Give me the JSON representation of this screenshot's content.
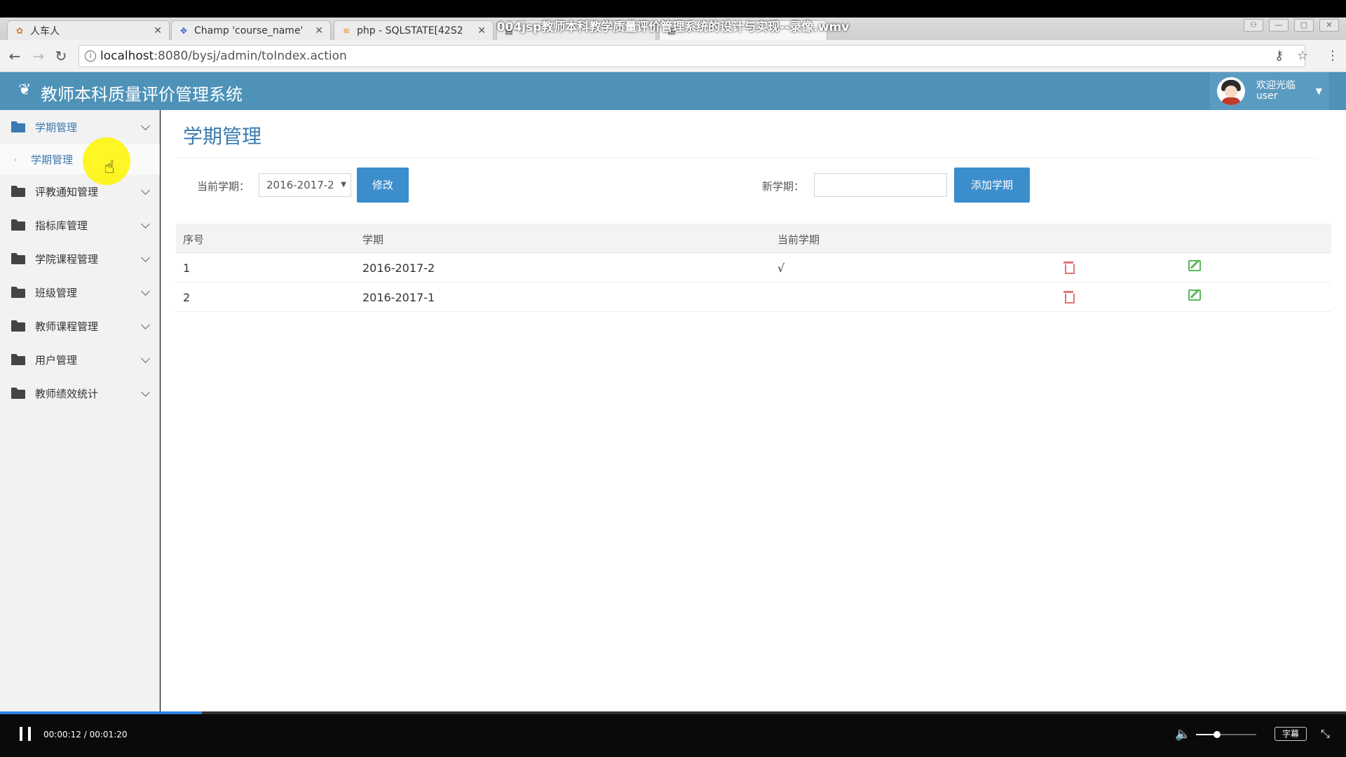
{
  "video": {
    "title": "004jsp教师本科教学质量评价管理系统的设计与实现--录像.wmv",
    "current_time": "00:00:12",
    "total_time": "00:01:20",
    "progress": 0.15,
    "time_separator": "/",
    "volume": 0.35,
    "subtitle_label": "字幕"
  },
  "browser": {
    "tabs": [
      {
        "label": "人车人",
        "icon": "app-icon"
      },
      {
        "label": "Champ 'course_name'",
        "icon": "baidu-icon"
      },
      {
        "label": "php - SQLSTATE[42S2",
        "icon": "stackoverflow-icon"
      },
      {
        "label": "",
        "icon": "page-icon"
      },
      {
        "label": "",
        "icon": "page-icon"
      }
    ],
    "url_host": "localhost",
    "url_path": ":8080/bysj/admin/toIndex.action"
  },
  "app": {
    "title": "教师本科质量评价管理系统",
    "logo_icon": "leaf-icon",
    "accent_color": "#4e92b8",
    "user": {
      "welcome": "欢迎光临",
      "name": "user"
    }
  },
  "sidebar": {
    "items": [
      {
        "label": "学期管理",
        "open": true
      },
      {
        "label": "评教通知管理",
        "open": false
      },
      {
        "label": "指标库管理",
        "open": false
      },
      {
        "label": "学院课程管理",
        "open": false
      },
      {
        "label": "班级管理",
        "open": false
      },
      {
        "label": "教师课程管理",
        "open": false
      },
      {
        "label": "用户管理",
        "open": false
      },
      {
        "label": "教师绩效统计",
        "open": false
      }
    ],
    "submenu": {
      "label": "学期管理"
    }
  },
  "main": {
    "page_title": "学期管理",
    "current_term_label": "当前学期：",
    "current_term_value": "2016-2017-2",
    "modify_button": "修改",
    "new_term_label": "新学期：",
    "new_term_value": "",
    "add_button": "添加学期",
    "table": {
      "headers": [
        "序号",
        "学期",
        "当前学期"
      ],
      "rows": [
        {
          "index": "1",
          "term": "2016-2017-2",
          "current": "√"
        },
        {
          "index": "2",
          "term": "2016-2017-1",
          "current": ""
        }
      ]
    }
  }
}
